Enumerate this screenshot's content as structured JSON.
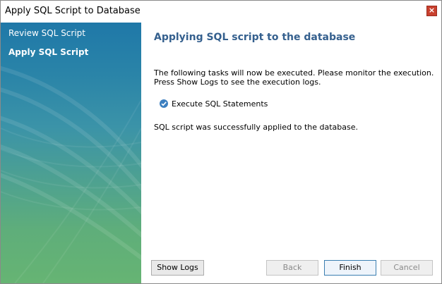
{
  "window": {
    "title": "Apply SQL Script to Database",
    "close_glyph": "×"
  },
  "sidebar": {
    "steps": [
      {
        "label": "Review SQL Script",
        "active": false
      },
      {
        "label": "Apply SQL Script",
        "active": true
      }
    ]
  },
  "main": {
    "heading": "Applying SQL script to the database",
    "description_line1": "The following tasks will now be executed. Please monitor the execution.",
    "description_line2": "Press Show Logs to see the execution logs.",
    "task": {
      "label": "Execute SQL Statements",
      "status_icon": "check-circle-icon",
      "done": true
    },
    "result": "SQL script was successfully applied to the database."
  },
  "buttons": {
    "show_logs": "Show Logs",
    "back": "Back",
    "finish": "Finish",
    "cancel": "Cancel"
  },
  "colors": {
    "heading": "#35608e",
    "sidebar_top": "#1f78a8",
    "sidebar_bottom": "#66b473",
    "close": "#c8402e"
  }
}
